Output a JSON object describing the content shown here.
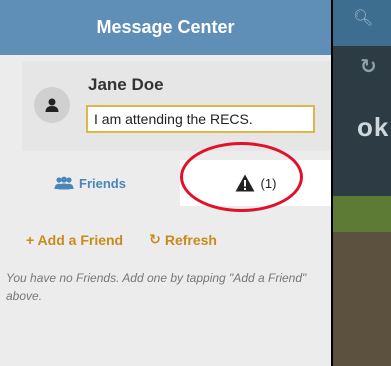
{
  "header": {
    "title": "Message Center"
  },
  "profile": {
    "name": "Jane Doe",
    "status_value": "I am attending the RECS."
  },
  "tabs": {
    "friends_label": "Friends",
    "alerts_count": "(1)"
  },
  "actions": {
    "add_label": "+ Add a Friend",
    "refresh_label": "Refresh"
  },
  "empty_message": "You have no Friends. Add one by tapping \"Add a Friend\" above.",
  "background": {
    "partial_text": "ok"
  },
  "colors": {
    "header": "#5f8fb7",
    "accent": "#c98a1d",
    "tab_active": "#4a86b8",
    "highlight": "#e4102a"
  }
}
